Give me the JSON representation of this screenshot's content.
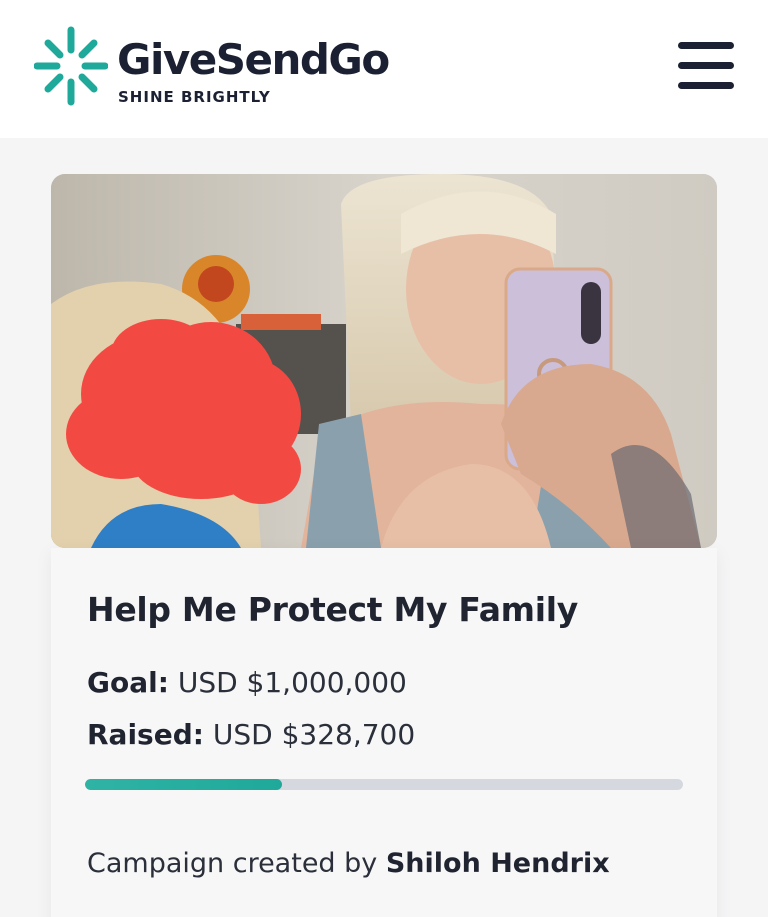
{
  "header": {
    "brand_name": "GiveSendGo",
    "tagline": "SHINE BRIGHTLY",
    "logo_icon": "starburst-logo-icon",
    "menu_icon": "hamburger-menu-icon",
    "brand_color": "#1fa99a"
  },
  "campaign": {
    "image_alt": "Photo of campaign creator taking a mirror selfie with a child whose face is covered",
    "title": "Help Me Protect My Family",
    "goal_label": "Goal:",
    "goal_value": "USD $1,000,000",
    "raised_label": "Raised:",
    "raised_value": "USD $328,700",
    "progress_fraction": 0.3287,
    "creator_prefix": "Campaign created by",
    "creator_name": "Shiloh Hendrix"
  }
}
